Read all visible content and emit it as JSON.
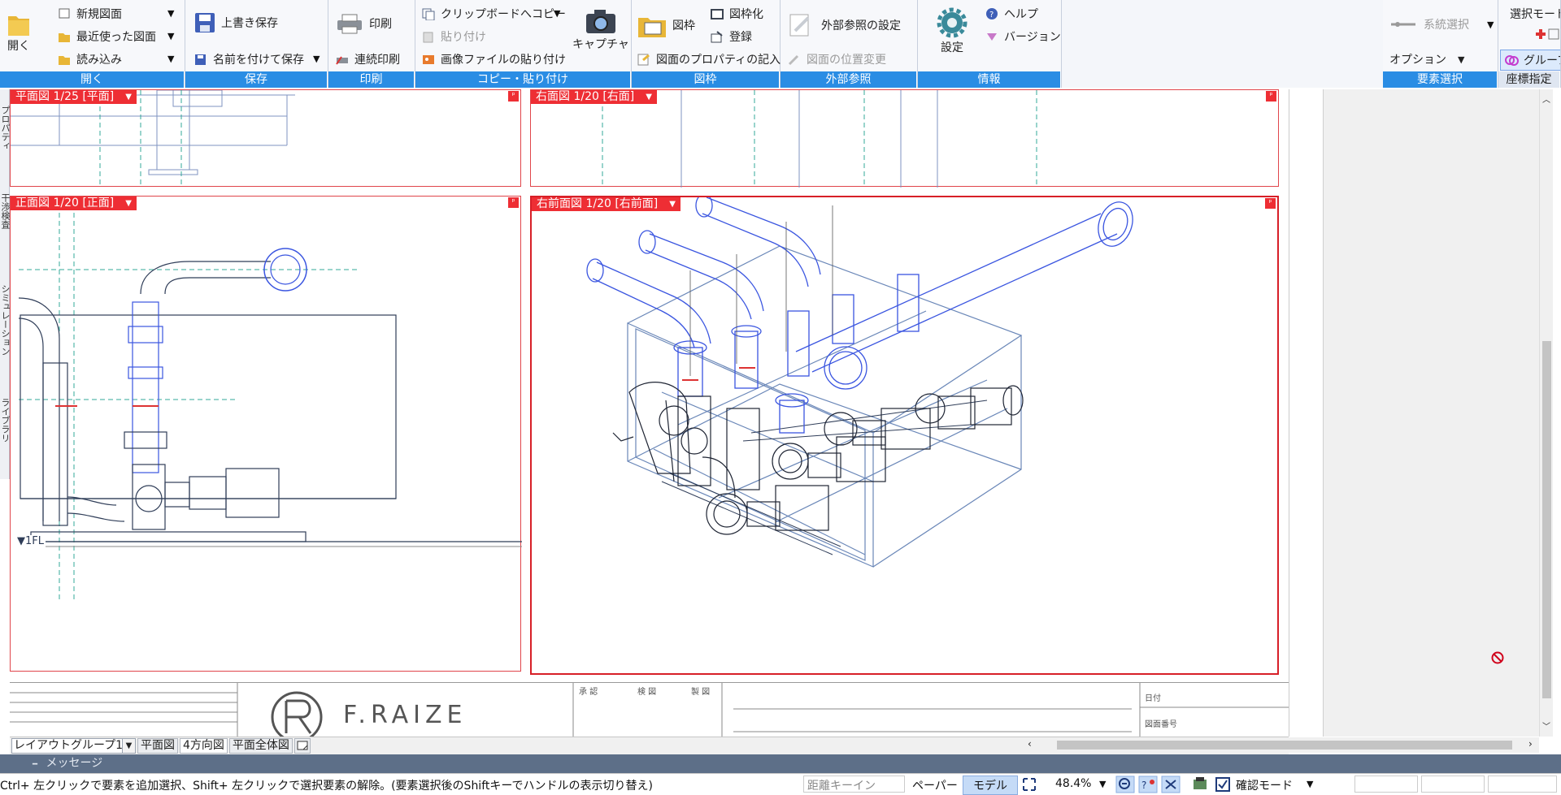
{
  "ribbon": {
    "groups": {
      "open": {
        "label": "開く",
        "big_button": "開く",
        "items": [
          "新規図面",
          "最近使った図面",
          "読み込み"
        ]
      },
      "save": {
        "label": "保存",
        "items": [
          "上書き保存",
          "名前を付けて保存"
        ]
      },
      "print": {
        "label": "印刷",
        "items": [
          "印刷",
          "連続印刷"
        ]
      },
      "clipboard": {
        "label": "コピー・貼り付け",
        "items": [
          "クリップボードへコピー",
          "貼り付け",
          "画像ファイルの貼り付け"
        ],
        "big_button": "キャプチャ"
      },
      "frame": {
        "label": "図枠",
        "items": [
          "図枠",
          "図枠化",
          "登録",
          "図面のプロパティの記入"
        ]
      },
      "xref": {
        "label": "外部参照",
        "items": [
          "外部参照の設定",
          "図面の位置変更"
        ]
      },
      "info": {
        "label": "情報",
        "big_button": "設定",
        "items": [
          "ヘルプ",
          "バージョン"
        ]
      },
      "select": {
        "label": "要素選択",
        "items": [
          "系統選択",
          "オプション"
        ]
      },
      "coord": {
        "label": "座標指定",
        "items": [
          "選択モード",
          "グループ"
        ]
      }
    }
  },
  "side_tabs": [
    "プロパティ",
    "干渉検査",
    "シミュレーション",
    "ライブラリ"
  ],
  "viewports": {
    "plan": {
      "title": "平面図 1/25 [平面]"
    },
    "right": {
      "title": "右面図 1/20 [右面]"
    },
    "front": {
      "title": "正面図 1/20 [正面]",
      "floor_label": "▼1FL"
    },
    "iso": {
      "title": "右前面図 1/20 [右前面]"
    }
  },
  "title_block": {
    "brand": "F.RAIZE",
    "fields": [
      "承 認",
      "検 図",
      "製 図",
      "日付",
      "図面番号"
    ]
  },
  "layout_bar": {
    "group_select": "レイアウトグループ1",
    "tabs": [
      "平面図",
      "4方向図",
      "平面全体図"
    ]
  },
  "message_bar": {
    "label": "メッセージ"
  },
  "status_bar": {
    "hint": "Ctrl+ 左クリックで要素を追加選択、Shift+ 左クリックで選択要素の解除。(要素選択後のShiftキーでハンドルの表示切り替え)",
    "distance_placeholder": "距離キーイン",
    "paper": "ペーパー",
    "model": "モデル",
    "zoom": "48.4%",
    "mode": "確認モード"
  },
  "colors": {
    "ribbon_label": "#2a8de4",
    "viewport_title": "#ee2e34",
    "model_lines": "#3a55e0",
    "frame_lines": "#6a87b8",
    "message_bar": "#5d6f88"
  }
}
